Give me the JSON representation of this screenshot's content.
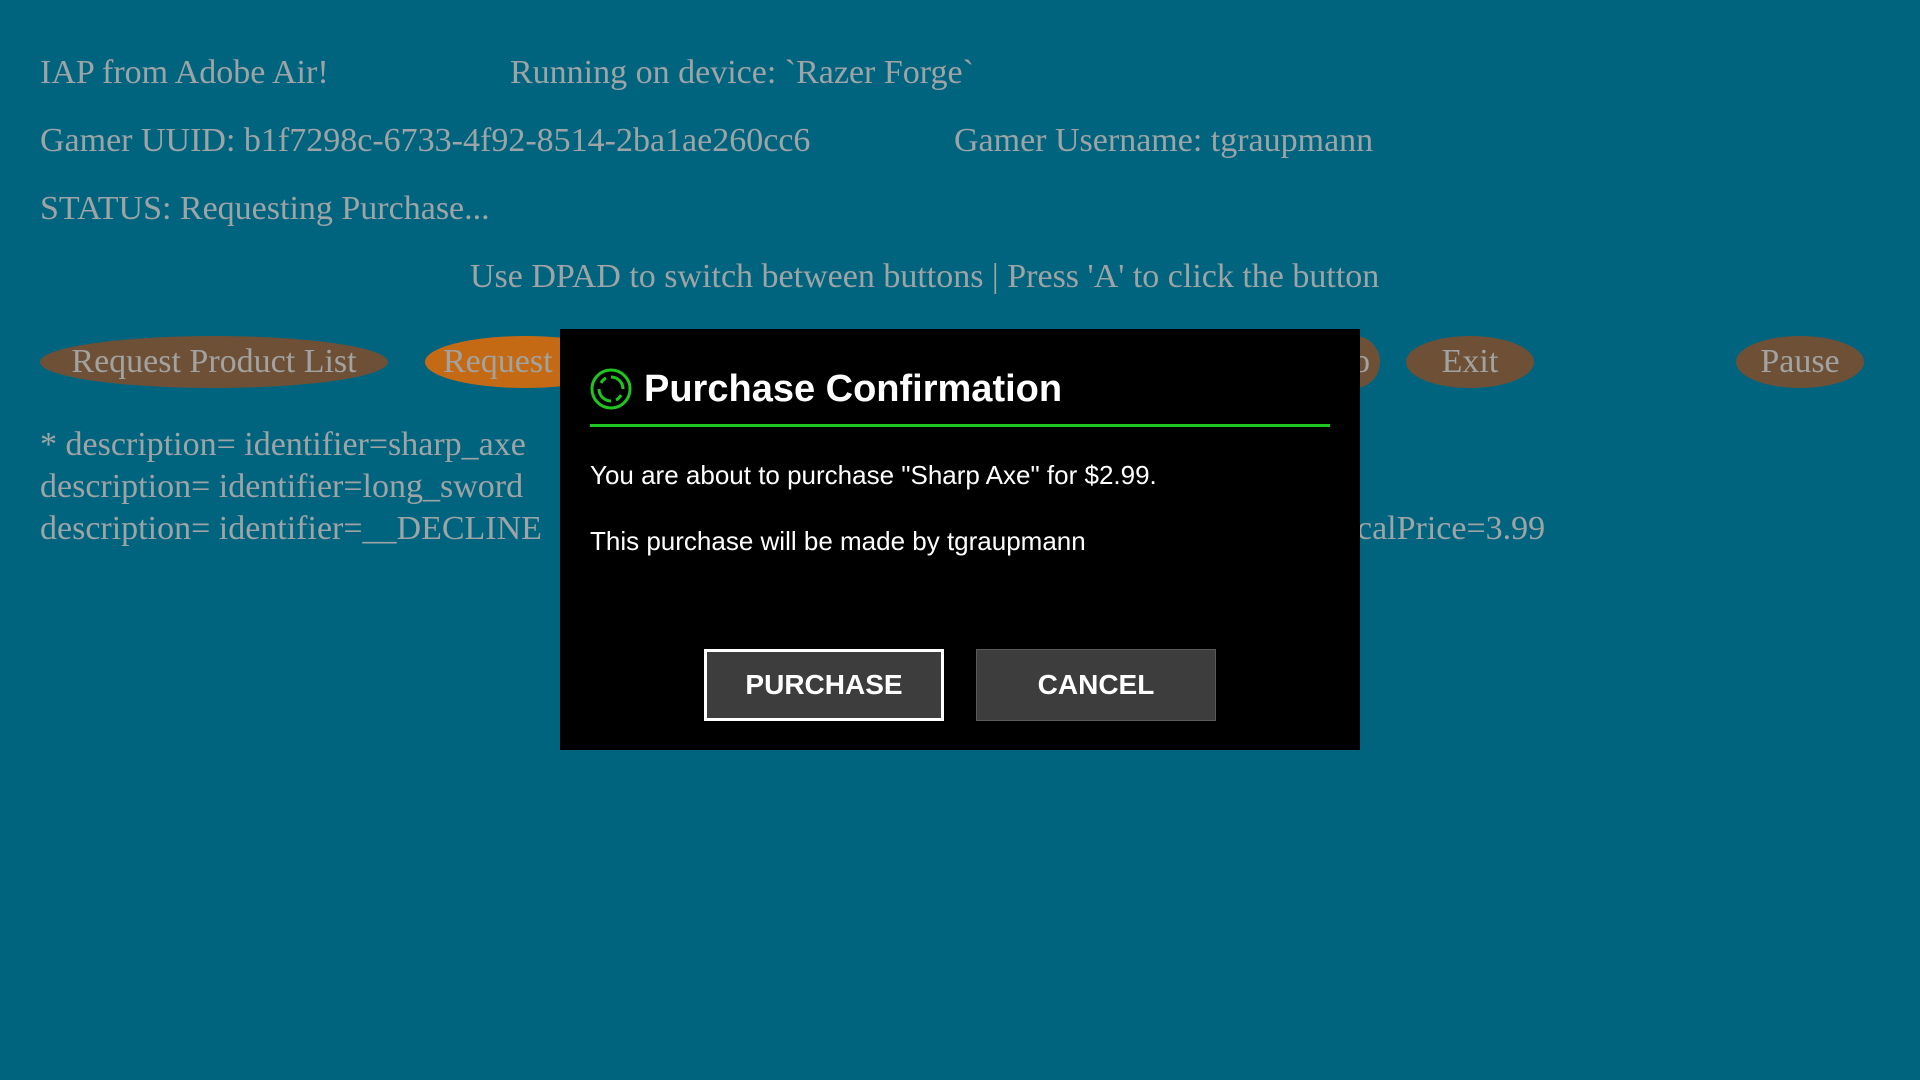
{
  "header": {
    "app_title": "IAP from Adobe Air!",
    "device": "Running on device: `Razer Forge`",
    "gamer_uuid": "Gamer UUID: b1f7298c-6733-4f92-8514-2ba1ae260cc6",
    "gamer_username": "Gamer Username: tgraupmann",
    "status": "STATUS: Requesting Purchase...",
    "instructions": "Use DPAD to switch between buttons | Press 'A' to click the button"
  },
  "buttons": {
    "request_product_list": "Request Product List",
    "request_purchase": "Request",
    "exit": "Exit",
    "pause": "Pause",
    "hidden_partial": "o"
  },
  "log": {
    "lines": [
      "* description= identifier=sharp_axe",
      "description= identifier=long_sword",
      "description= identifier=__DECLINE"
    ],
    "right_fragment": "ocalPrice=3.99"
  },
  "dialog": {
    "title": "Purchase Confirmation",
    "message": "You are about to purchase \"Sharp Axe\" for $2.99.",
    "made_by": "This purchase will be made by tgraupmann",
    "purchase_label": "PURCHASE",
    "cancel_label": "CANCEL",
    "accent_color": "#1fc41f",
    "icon": "razer-ring-icon"
  }
}
